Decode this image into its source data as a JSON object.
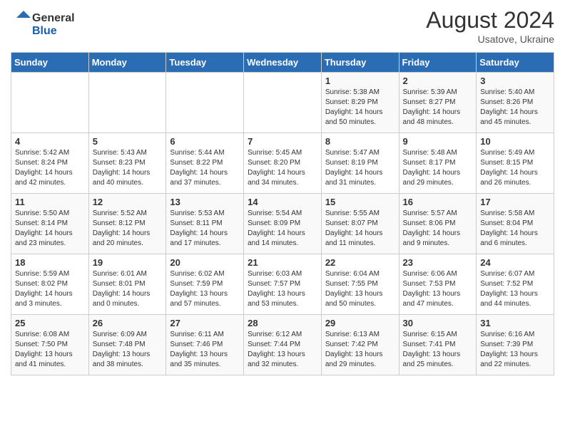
{
  "header": {
    "logo_text_general": "General",
    "logo_text_blue": "Blue",
    "month": "August 2024",
    "location": "Usatove, Ukraine"
  },
  "days_of_week": [
    "Sunday",
    "Monday",
    "Tuesday",
    "Wednesday",
    "Thursday",
    "Friday",
    "Saturday"
  ],
  "weeks": [
    [
      {
        "day": "",
        "info": ""
      },
      {
        "day": "",
        "info": ""
      },
      {
        "day": "",
        "info": ""
      },
      {
        "day": "",
        "info": ""
      },
      {
        "day": "1",
        "info": "Sunrise: 5:38 AM\nSunset: 8:29 PM\nDaylight: 14 hours\nand 50 minutes."
      },
      {
        "day": "2",
        "info": "Sunrise: 5:39 AM\nSunset: 8:27 PM\nDaylight: 14 hours\nand 48 minutes."
      },
      {
        "day": "3",
        "info": "Sunrise: 5:40 AM\nSunset: 8:26 PM\nDaylight: 14 hours\nand 45 minutes."
      }
    ],
    [
      {
        "day": "4",
        "info": "Sunrise: 5:42 AM\nSunset: 8:24 PM\nDaylight: 14 hours\nand 42 minutes."
      },
      {
        "day": "5",
        "info": "Sunrise: 5:43 AM\nSunset: 8:23 PM\nDaylight: 14 hours\nand 40 minutes."
      },
      {
        "day": "6",
        "info": "Sunrise: 5:44 AM\nSunset: 8:22 PM\nDaylight: 14 hours\nand 37 minutes."
      },
      {
        "day": "7",
        "info": "Sunrise: 5:45 AM\nSunset: 8:20 PM\nDaylight: 14 hours\nand 34 minutes."
      },
      {
        "day": "8",
        "info": "Sunrise: 5:47 AM\nSunset: 8:19 PM\nDaylight: 14 hours\nand 31 minutes."
      },
      {
        "day": "9",
        "info": "Sunrise: 5:48 AM\nSunset: 8:17 PM\nDaylight: 14 hours\nand 29 minutes."
      },
      {
        "day": "10",
        "info": "Sunrise: 5:49 AM\nSunset: 8:15 PM\nDaylight: 14 hours\nand 26 minutes."
      }
    ],
    [
      {
        "day": "11",
        "info": "Sunrise: 5:50 AM\nSunset: 8:14 PM\nDaylight: 14 hours\nand 23 minutes."
      },
      {
        "day": "12",
        "info": "Sunrise: 5:52 AM\nSunset: 8:12 PM\nDaylight: 14 hours\nand 20 minutes."
      },
      {
        "day": "13",
        "info": "Sunrise: 5:53 AM\nSunset: 8:11 PM\nDaylight: 14 hours\nand 17 minutes."
      },
      {
        "day": "14",
        "info": "Sunrise: 5:54 AM\nSunset: 8:09 PM\nDaylight: 14 hours\nand 14 minutes."
      },
      {
        "day": "15",
        "info": "Sunrise: 5:55 AM\nSunset: 8:07 PM\nDaylight: 14 hours\nand 11 minutes."
      },
      {
        "day": "16",
        "info": "Sunrise: 5:57 AM\nSunset: 8:06 PM\nDaylight: 14 hours\nand 9 minutes."
      },
      {
        "day": "17",
        "info": "Sunrise: 5:58 AM\nSunset: 8:04 PM\nDaylight: 14 hours\nand 6 minutes."
      }
    ],
    [
      {
        "day": "18",
        "info": "Sunrise: 5:59 AM\nSunset: 8:02 PM\nDaylight: 14 hours\nand 3 minutes."
      },
      {
        "day": "19",
        "info": "Sunrise: 6:01 AM\nSunset: 8:01 PM\nDaylight: 14 hours\nand 0 minutes."
      },
      {
        "day": "20",
        "info": "Sunrise: 6:02 AM\nSunset: 7:59 PM\nDaylight: 13 hours\nand 57 minutes."
      },
      {
        "day": "21",
        "info": "Sunrise: 6:03 AM\nSunset: 7:57 PM\nDaylight: 13 hours\nand 53 minutes."
      },
      {
        "day": "22",
        "info": "Sunrise: 6:04 AM\nSunset: 7:55 PM\nDaylight: 13 hours\nand 50 minutes."
      },
      {
        "day": "23",
        "info": "Sunrise: 6:06 AM\nSunset: 7:53 PM\nDaylight: 13 hours\nand 47 minutes."
      },
      {
        "day": "24",
        "info": "Sunrise: 6:07 AM\nSunset: 7:52 PM\nDaylight: 13 hours\nand 44 minutes."
      }
    ],
    [
      {
        "day": "25",
        "info": "Sunrise: 6:08 AM\nSunset: 7:50 PM\nDaylight: 13 hours\nand 41 minutes."
      },
      {
        "day": "26",
        "info": "Sunrise: 6:09 AM\nSunset: 7:48 PM\nDaylight: 13 hours\nand 38 minutes."
      },
      {
        "day": "27",
        "info": "Sunrise: 6:11 AM\nSunset: 7:46 PM\nDaylight: 13 hours\nand 35 minutes."
      },
      {
        "day": "28",
        "info": "Sunrise: 6:12 AM\nSunset: 7:44 PM\nDaylight: 13 hours\nand 32 minutes."
      },
      {
        "day": "29",
        "info": "Sunrise: 6:13 AM\nSunset: 7:42 PM\nDaylight: 13 hours\nand 29 minutes."
      },
      {
        "day": "30",
        "info": "Sunrise: 6:15 AM\nSunset: 7:41 PM\nDaylight: 13 hours\nand 25 minutes."
      },
      {
        "day": "31",
        "info": "Sunrise: 6:16 AM\nSunset: 7:39 PM\nDaylight: 13 hours\nand 22 minutes."
      }
    ]
  ]
}
